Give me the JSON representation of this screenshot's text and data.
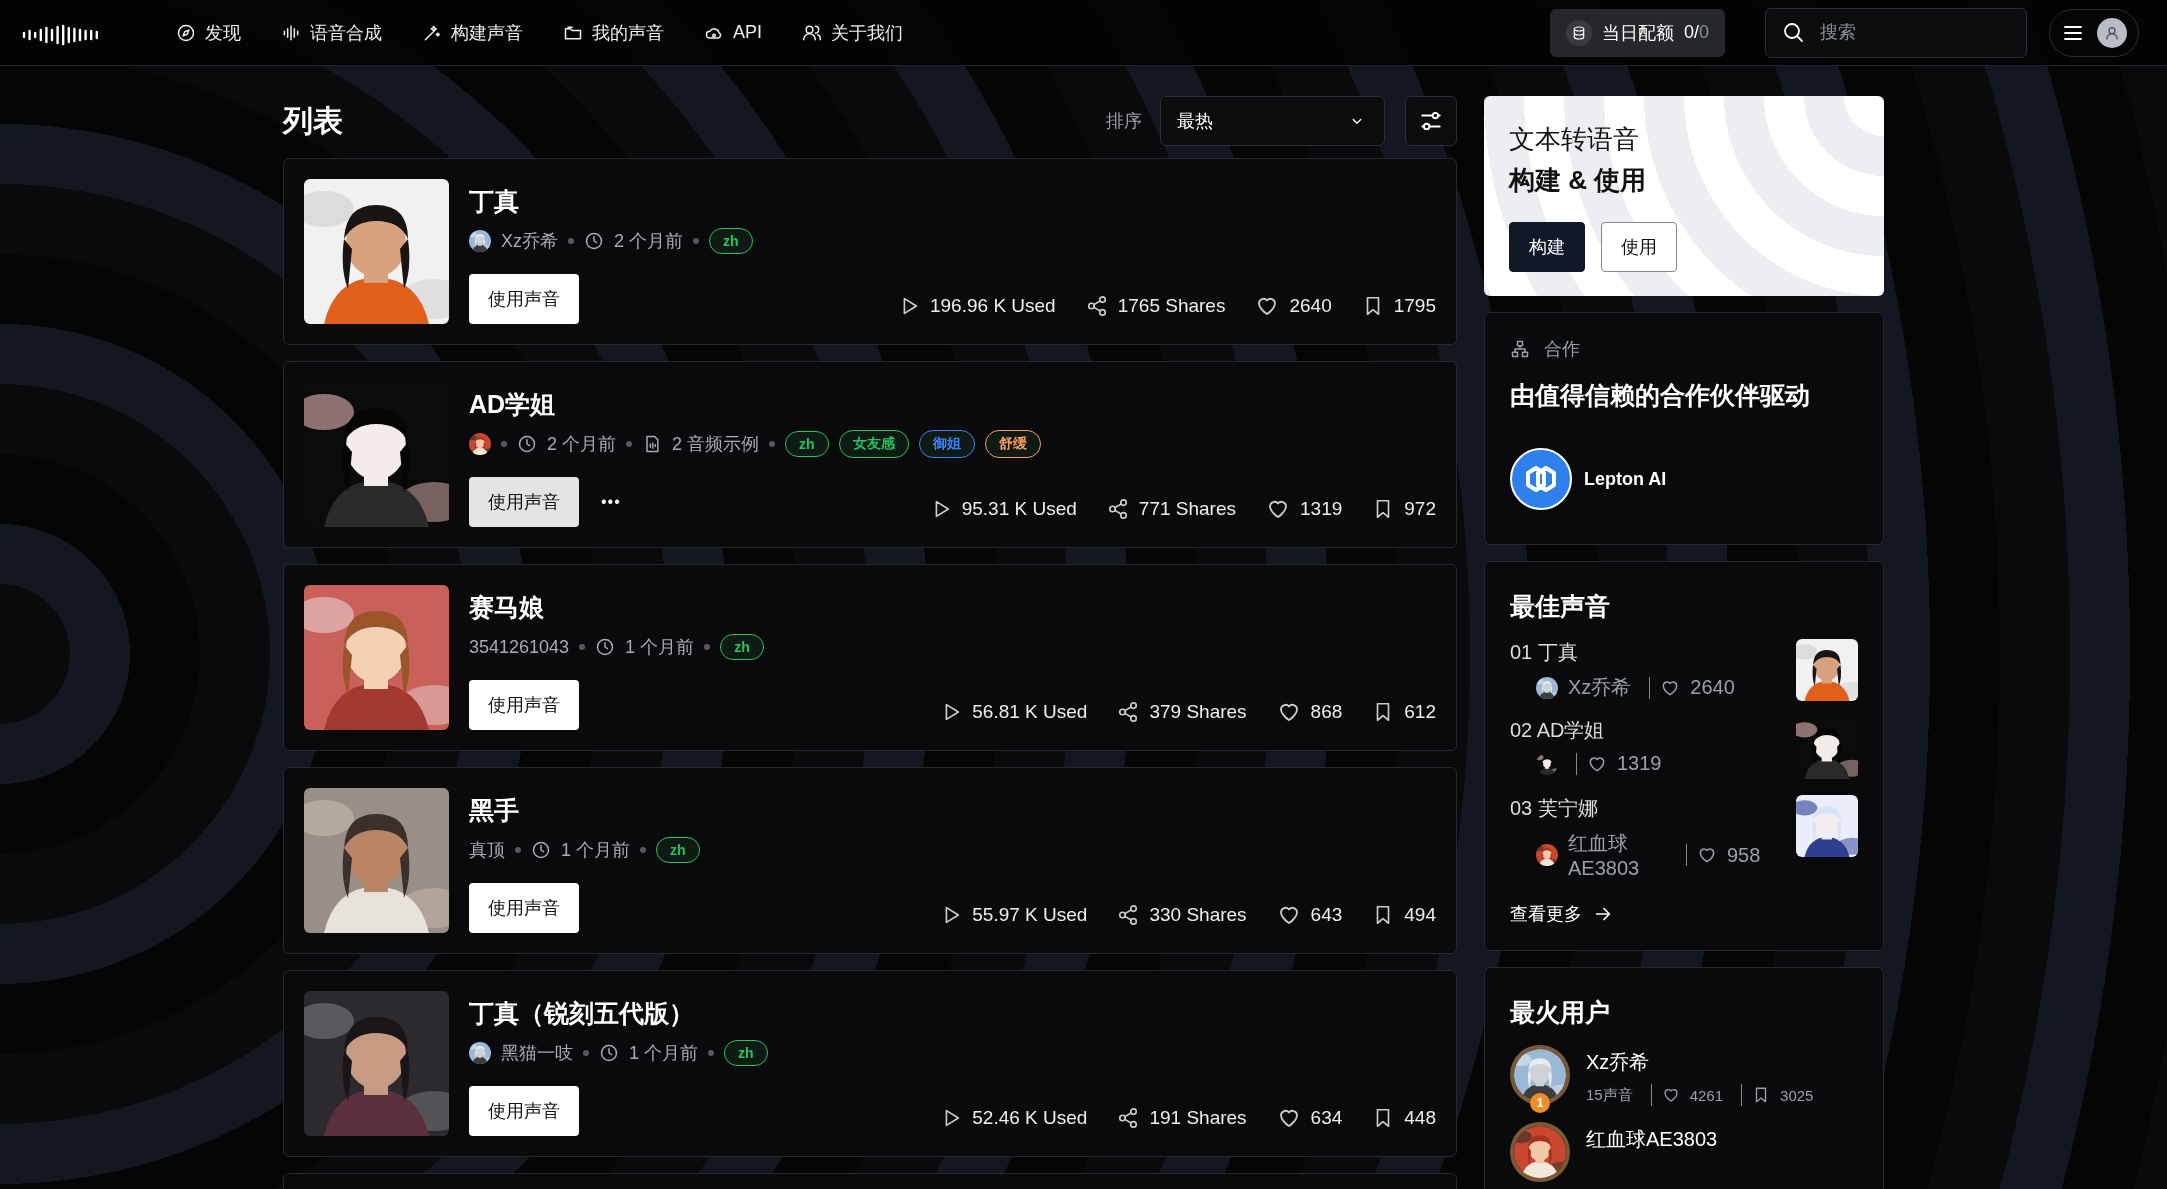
{
  "header": {
    "nav": [
      {
        "label": "发现"
      },
      {
        "label": "语音合成"
      },
      {
        "label": "构建声音"
      },
      {
        "label": "我的声音"
      },
      {
        "label": "API"
      },
      {
        "label": "关于我们"
      }
    ],
    "quota": {
      "label": "当日配额",
      "used": "0/",
      "limit": "0"
    },
    "search": {
      "placeholder": "搜索"
    }
  },
  "list": {
    "title": "列表",
    "sort_label": "排序",
    "sort_value": "最热",
    "cards": [
      {
        "title": "丁真",
        "author": "Xz乔希",
        "author_avatar": true,
        "time": "2 个月前",
        "tags": [
          {
            "label": "zh",
            "color": "#22c55e"
          }
        ],
        "button": {
          "label": "使用声音",
          "hovered": false
        },
        "stats": {
          "used": "196.96 K Used",
          "shares": "1765 Shares",
          "likes": "2640",
          "saves": "1795"
        }
      },
      {
        "title": "AD学姐",
        "author_avatar": true,
        "time": "2 个月前",
        "samples": "2 音频示例",
        "tags": [
          {
            "label": "zh",
            "color": "#22c55e"
          },
          {
            "label": "女友感",
            "color": "#22c55e"
          },
          {
            "label": "御姐",
            "color": "#3b82f6"
          },
          {
            "label": "舒缓",
            "color": "#f59e5b"
          }
        ],
        "button": {
          "label": "使用声音",
          "hovered": true
        },
        "more": "•••",
        "stats": {
          "used": "95.31 K Used",
          "shares": "771 Shares",
          "likes": "1319",
          "saves": "972"
        }
      },
      {
        "title": "赛马娘",
        "author": "3541261043",
        "author_avatar": false,
        "time": "1 个月前",
        "tags": [
          {
            "label": "zh",
            "color": "#22c55e"
          }
        ],
        "button": {
          "label": "使用声音",
          "hovered": false
        },
        "stats": {
          "used": "56.81 K Used",
          "shares": "379 Shares",
          "likes": "868",
          "saves": "612"
        }
      },
      {
        "title": "黑手",
        "author": "真顶",
        "author_avatar": false,
        "time": "1 个月前",
        "tags": [
          {
            "label": "zh",
            "color": "#22c55e"
          }
        ],
        "button": {
          "label": "使用声音",
          "hovered": false
        },
        "stats": {
          "used": "55.97 K Used",
          "shares": "330 Shares",
          "likes": "643",
          "saves": "494"
        }
      },
      {
        "title": "丁真（锐刻五代版）",
        "author": "黑猫一吱",
        "author_avatar": true,
        "time": "1 个月前",
        "tags": [
          {
            "label": "zh",
            "color": "#22c55e"
          }
        ],
        "button": {
          "label": "使用声音",
          "hovered": false
        },
        "stats": {
          "used": "52.46 K Used",
          "shares": "191 Shares",
          "likes": "634",
          "saves": "448"
        }
      }
    ]
  },
  "sidebar": {
    "hero": {
      "line1": "文本转语音",
      "line2": "构建 & 使用",
      "buttons": [
        {
          "label": "构建",
          "primary": true
        },
        {
          "label": "使用",
          "primary": false
        }
      ]
    },
    "partners": {
      "eyebrow": "合作",
      "title": "由值得信赖的合作伙伴驱动",
      "items": [
        {
          "name": "Lepton AI"
        }
      ]
    },
    "best_voices": {
      "title": "最佳声音",
      "items": [
        {
          "rank": "01",
          "name": "丁真",
          "author": "Xz乔希",
          "likes": "2640"
        },
        {
          "rank": "02",
          "name": "AD学姐",
          "likes": "1319"
        },
        {
          "rank": "03",
          "name": "芙宁娜",
          "author": "红血球AE3803",
          "likes": "958"
        }
      ],
      "more": "查看更多"
    },
    "top_users": {
      "title": "最火用户",
      "users": [
        {
          "name": "Xz乔希",
          "badge": "1",
          "voices": "15声音",
          "likes": "4261",
          "saves": "3025"
        },
        {
          "name": "红血球AE3803"
        }
      ]
    }
  }
}
